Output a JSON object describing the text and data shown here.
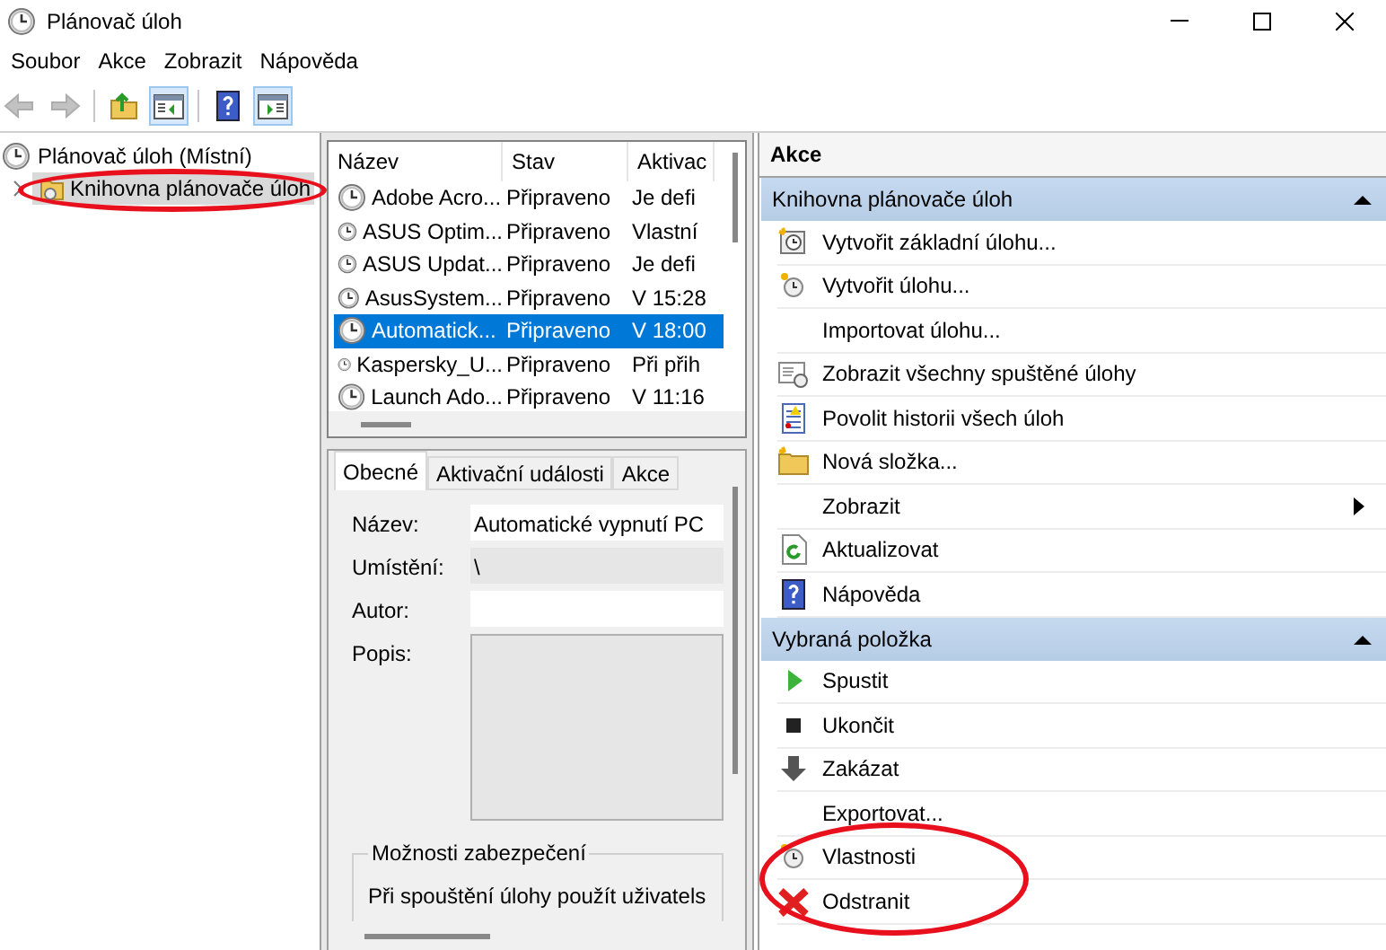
{
  "window": {
    "title": "Plánovač úloh"
  },
  "menu": [
    "Soubor",
    "Akce",
    "Zobrazit",
    "Nápověda"
  ],
  "toolbar": [
    {
      "kind": "back",
      "disabled": true,
      "pressed": false
    },
    {
      "kind": "forward",
      "disabled": true,
      "pressed": false
    },
    {
      "kind": "sep"
    },
    {
      "kind": "up",
      "disabled": false,
      "pressed": false
    },
    {
      "kind": "tree",
      "disabled": false,
      "pressed": true
    },
    {
      "kind": "sep"
    },
    {
      "kind": "help",
      "disabled": false,
      "pressed": false
    },
    {
      "kind": "pane",
      "disabled": false,
      "pressed": true
    }
  ],
  "tree": {
    "label": "Plánovač úloh (Místní)",
    "children": [
      {
        "label": "Knihovna plánovače úloh",
        "selected": true,
        "circled": true
      }
    ]
  },
  "task_list": {
    "columns": [
      "Název",
      "Stav",
      "Aktivac"
    ],
    "rows": [
      {
        "cells": [
          "Adobe Acro...",
          "Připraveno",
          "Je defi"
        ],
        "selected": false
      },
      {
        "cells": [
          "ASUS Optim...",
          "Připraveno",
          "Vlastní"
        ],
        "selected": false
      },
      {
        "cells": [
          "ASUS Updat...",
          "Připraveno",
          "Je defi"
        ],
        "selected": false
      },
      {
        "cells": [
          "AsusSystem...",
          "Připraveno",
          "V 15:28"
        ],
        "selected": false
      },
      {
        "cells": [
          "Automatick...",
          "Připraveno",
          "V 18:00"
        ],
        "selected": true
      },
      {
        "cells": [
          "Kaspersky_U...",
          "Připraveno",
          "Při přih"
        ],
        "selected": false
      },
      {
        "cells": [
          "Launch Ado...",
          "Připraveno",
          "V 11:16"
        ],
        "selected": false
      }
    ]
  },
  "details": {
    "tabs": [
      {
        "label": "Obecné",
        "selected": true
      },
      {
        "label": "Aktivační události",
        "selected": false
      },
      {
        "label": "Akce",
        "selected": false
      }
    ],
    "fields": [
      {
        "label": "Název:",
        "value": "Automatické vypnutí PC",
        "kind": "text"
      },
      {
        "label": "Umístění:",
        "value": "\\",
        "kind": "readonly"
      },
      {
        "label": "Autor:",
        "kind": "text"
      },
      {
        "label": "Popis:",
        "kind": "area"
      }
    ],
    "security": {
      "title": "Možnosti zabezpečení",
      "text": "Při spouštění úlohy použít uživatels"
    }
  },
  "actions": {
    "title": "Akce",
    "sections": [
      {
        "title": "Knihovna plánovače úloh",
        "expanded": true,
        "items": [
          {
            "label": "Vytvořit základní úlohu...",
            "kind": "wizard"
          },
          {
            "label": "Vytvořit úlohu...",
            "kind": "task"
          },
          {
            "label": "Importovat úlohu...",
            "kind": "plain"
          },
          {
            "label": "Zobrazit všechny spuštěné úlohy",
            "kind": "list"
          },
          {
            "label": "Povolit historii všech úloh",
            "kind": "log"
          },
          {
            "label": "Nová složka...",
            "kind": "folder"
          },
          {
            "label": "Zobrazit",
            "kind": "plain",
            "submenu": true
          },
          {
            "label": "Aktualizovat",
            "kind": "refresh"
          },
          {
            "label": "Nápověda",
            "kind": "help"
          }
        ]
      },
      {
        "title": "Vybraná položka",
        "expanded": true,
        "items": [
          {
            "label": "Spustit",
            "kind": "run"
          },
          {
            "label": "Ukončit",
            "kind": "stop"
          },
          {
            "label": "Zakázat",
            "kind": "disable"
          },
          {
            "label": "Exportovat...",
            "kind": "plain"
          },
          {
            "label": "Vlastnosti",
            "kind": "task",
            "circled": true
          },
          {
            "label": "Odstranit",
            "kind": "delete",
            "circled": true
          }
        ]
      }
    ]
  }
}
